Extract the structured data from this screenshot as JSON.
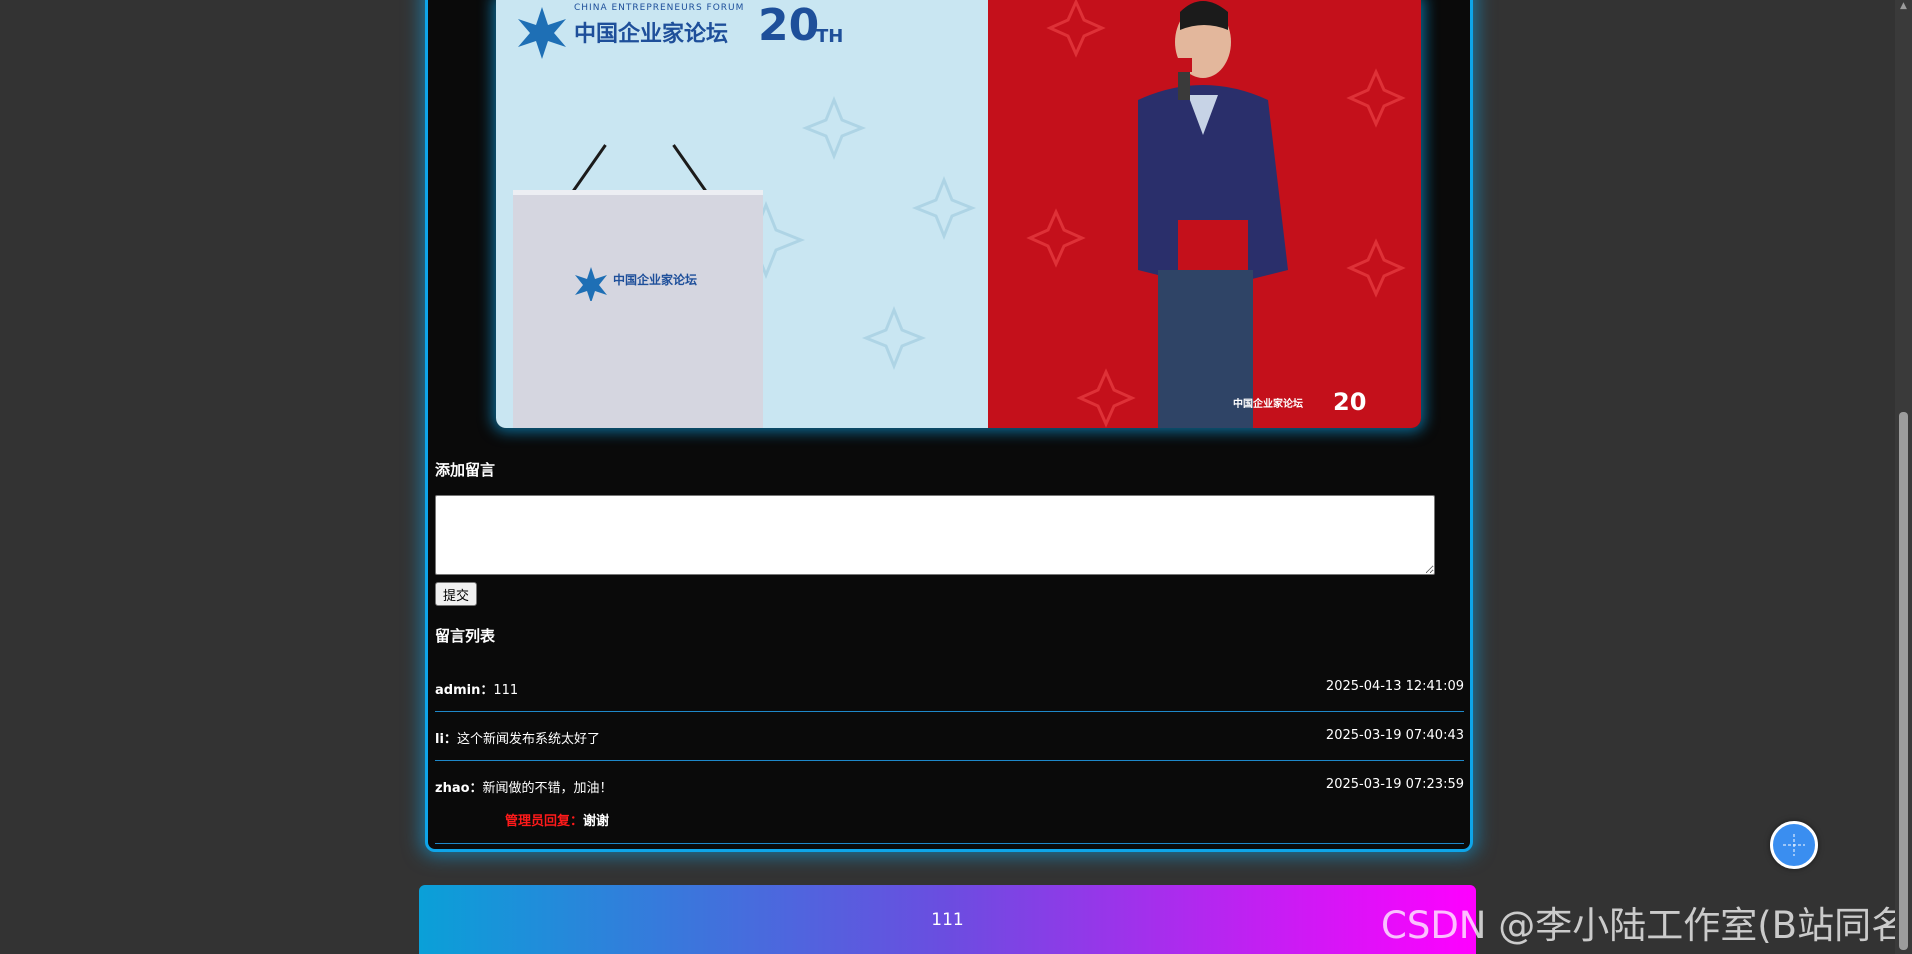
{
  "add_comment": {
    "title": "添加留言",
    "submit_label": "提交",
    "textarea_value": ""
  },
  "comment_list": {
    "title": "留言列表",
    "items": [
      {
        "user": "admin",
        "separator": "：",
        "text": "111",
        "time": "2025-04-13 12:41:09"
      },
      {
        "user": "li",
        "separator": "：",
        "text": "这个新闻发布系统太好了",
        "time": "2025-03-19 07:40:43"
      },
      {
        "user": "zhao",
        "separator": "：",
        "text": "新闻做的不错，加油！",
        "time": "2025-03-19 07:23:59",
        "reply_label": "管理员回复：",
        "reply_text": "谢谢"
      }
    ]
  },
  "hero": {
    "logo_cn": "中国企业家论坛",
    "logo_en": "CHINA ENTREPRENEURS FORUM",
    "anniversary": "20",
    "anniversary_suffix": "TH"
  },
  "footer": {
    "text": "111"
  },
  "watermark": {
    "text": "CSDN @李小陆工作室(B站同名)"
  },
  "colors": {
    "accent": "#0ea5e9",
    "reply_label": "#ff1a1a",
    "footer_start": "#0aa0d8",
    "footer_end": "#ff00ff"
  }
}
